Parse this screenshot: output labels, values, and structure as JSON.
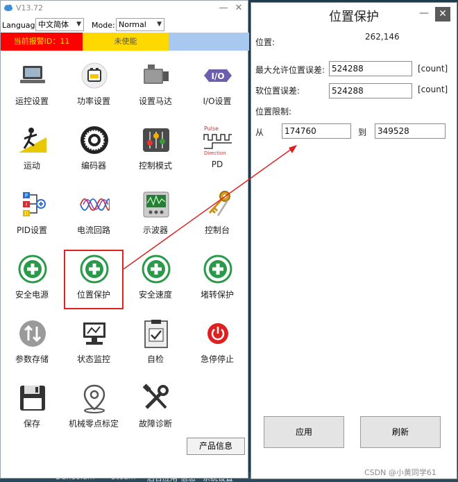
{
  "titlebar": {
    "version": "V13.72",
    "minimize": "—",
    "close": "✕"
  },
  "toolbar": {
    "language_label": "Language:",
    "language_value": "中文简体",
    "mode_label": "Mode:",
    "mode_value": "Normal"
  },
  "status": {
    "error_text": "当前报警ID：11",
    "state_text": "未使能",
    "colors": {
      "error": "#ff0000",
      "state": "#ffd800",
      "info": "#a9c8f0"
    }
  },
  "tiles": [
    {
      "label": "运控设置",
      "icon": "laptop-icon"
    },
    {
      "label": "功率设置",
      "icon": "battery-icon"
    },
    {
      "label": "设置马达",
      "icon": "motor-icon"
    },
    {
      "label": "I/O设置",
      "icon": "io-icon"
    },
    {
      "label": "运动",
      "icon": "runner-icon"
    },
    {
      "label": "编码器",
      "icon": "encoder-icon"
    },
    {
      "label": "控制模式",
      "icon": "control-mode-icon"
    },
    {
      "label": "PD",
      "icon": "pulse-direction-icon"
    },
    {
      "label": "PID设置",
      "icon": "pid-icon"
    },
    {
      "label": "电流回路",
      "icon": "current-loop-icon"
    },
    {
      "label": "示波器",
      "icon": "oscilloscope-icon"
    },
    {
      "label": "控制台",
      "icon": "console-keys-icon"
    },
    {
      "label": "安全电源",
      "icon": "safety-cross-icon"
    },
    {
      "label": "位置保护",
      "icon": "safety-cross-icon",
      "selected": true
    },
    {
      "label": "安全速度",
      "icon": "safety-cross-icon"
    },
    {
      "label": "堵转保护",
      "icon": "safety-cross-icon"
    },
    {
      "label": "参数存储",
      "icon": "swap-arrows-icon"
    },
    {
      "label": "状态监控",
      "icon": "monitor-icon"
    },
    {
      "label": "自检",
      "icon": "checklist-icon"
    },
    {
      "label": "急停停止",
      "icon": "power-stop-icon"
    },
    {
      "label": "保存",
      "icon": "floppy-disk-icon"
    },
    {
      "label": "机械零点标定",
      "icon": "map-pin-icon"
    },
    {
      "label": "故障诊断",
      "icon": "tools-icon"
    }
  ],
  "product_info_button": "产品信息",
  "dialog": {
    "title": "位置保护",
    "minimize": "—",
    "close": "✕",
    "position_label": "位置:",
    "position_value": "262,146",
    "max_error_label": "最大允许位置误差:",
    "max_error_value": "524288",
    "max_error_unit": "[count]",
    "soft_error_label": "软位置误差:",
    "soft_error_value": "524288",
    "soft_error_unit": "[count]",
    "limit_label": "位置限制:",
    "from_label": "从",
    "from_value": "174760",
    "to_label": "到",
    "to_value": "349528",
    "apply_button": "应用",
    "refresh_button": "刷新"
  },
  "taskbar": [
    "Dandolam",
    "Steam",
    "后台应用",
    "信息",
    "系统设置"
  ],
  "watermark": "CSDN @小黄同学61"
}
